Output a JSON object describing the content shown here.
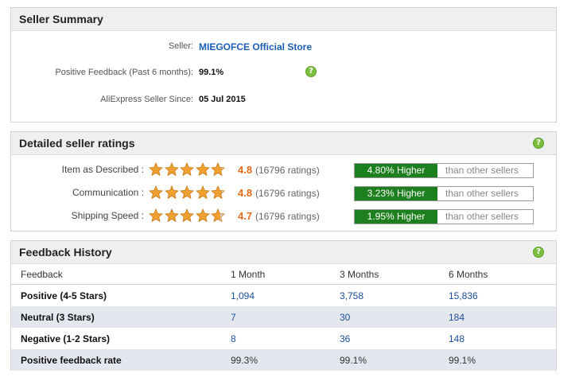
{
  "seller_summary": {
    "title": "Seller Summary",
    "seller_label": "Seller:",
    "seller_name": "MIEGOFCE Official Store",
    "positive_label": "Positive Feedback (Past 6 months):",
    "positive_value": "99.1%",
    "since_label": "AliExpress Seller Since:",
    "since_value": "05 Jul 2015",
    "help_icon": "question-icon"
  },
  "ratings": {
    "title": "Detailed seller ratings",
    "help_icon": "question-icon",
    "rows": [
      {
        "label": "Item as Described :",
        "stars": 4.8,
        "score": "4.8",
        "count": "(16796 ratings)",
        "higher": "4.80% Higher",
        "rest": "than other sellers"
      },
      {
        "label": "Communication :",
        "stars": 4.8,
        "score": "4.8",
        "count": "(16796 ratings)",
        "higher": "3.23% Higher",
        "rest": "than other sellers"
      },
      {
        "label": "Shipping Speed :",
        "stars": 4.7,
        "score": "4.7",
        "count": "(16796 ratings)",
        "higher": "1.95% Higher",
        "rest": "than other sellers"
      }
    ],
    "star_color": "#f0a030",
    "higher_color": "#1e7f1e"
  },
  "feedback_history": {
    "title": "Feedback History",
    "help_icon": "question-icon",
    "headers": [
      "Feedback",
      "1 Month",
      "3 Months",
      "6 Months"
    ],
    "rows": [
      {
        "label": "Positive (4-5 Stars)",
        "m1": "1,094",
        "m3": "3,758",
        "m6": "15,836"
      },
      {
        "label": "Neutral (3 Stars)",
        "m1": "7",
        "m3": "30",
        "m6": "184"
      },
      {
        "label": "Negative (1-2 Stars)",
        "m1": "8",
        "m3": "36",
        "m6": "148"
      },
      {
        "label": "Positive feedback rate",
        "m1": "99.3%",
        "m3": "99.1%",
        "m6": "99.1%"
      }
    ]
  }
}
